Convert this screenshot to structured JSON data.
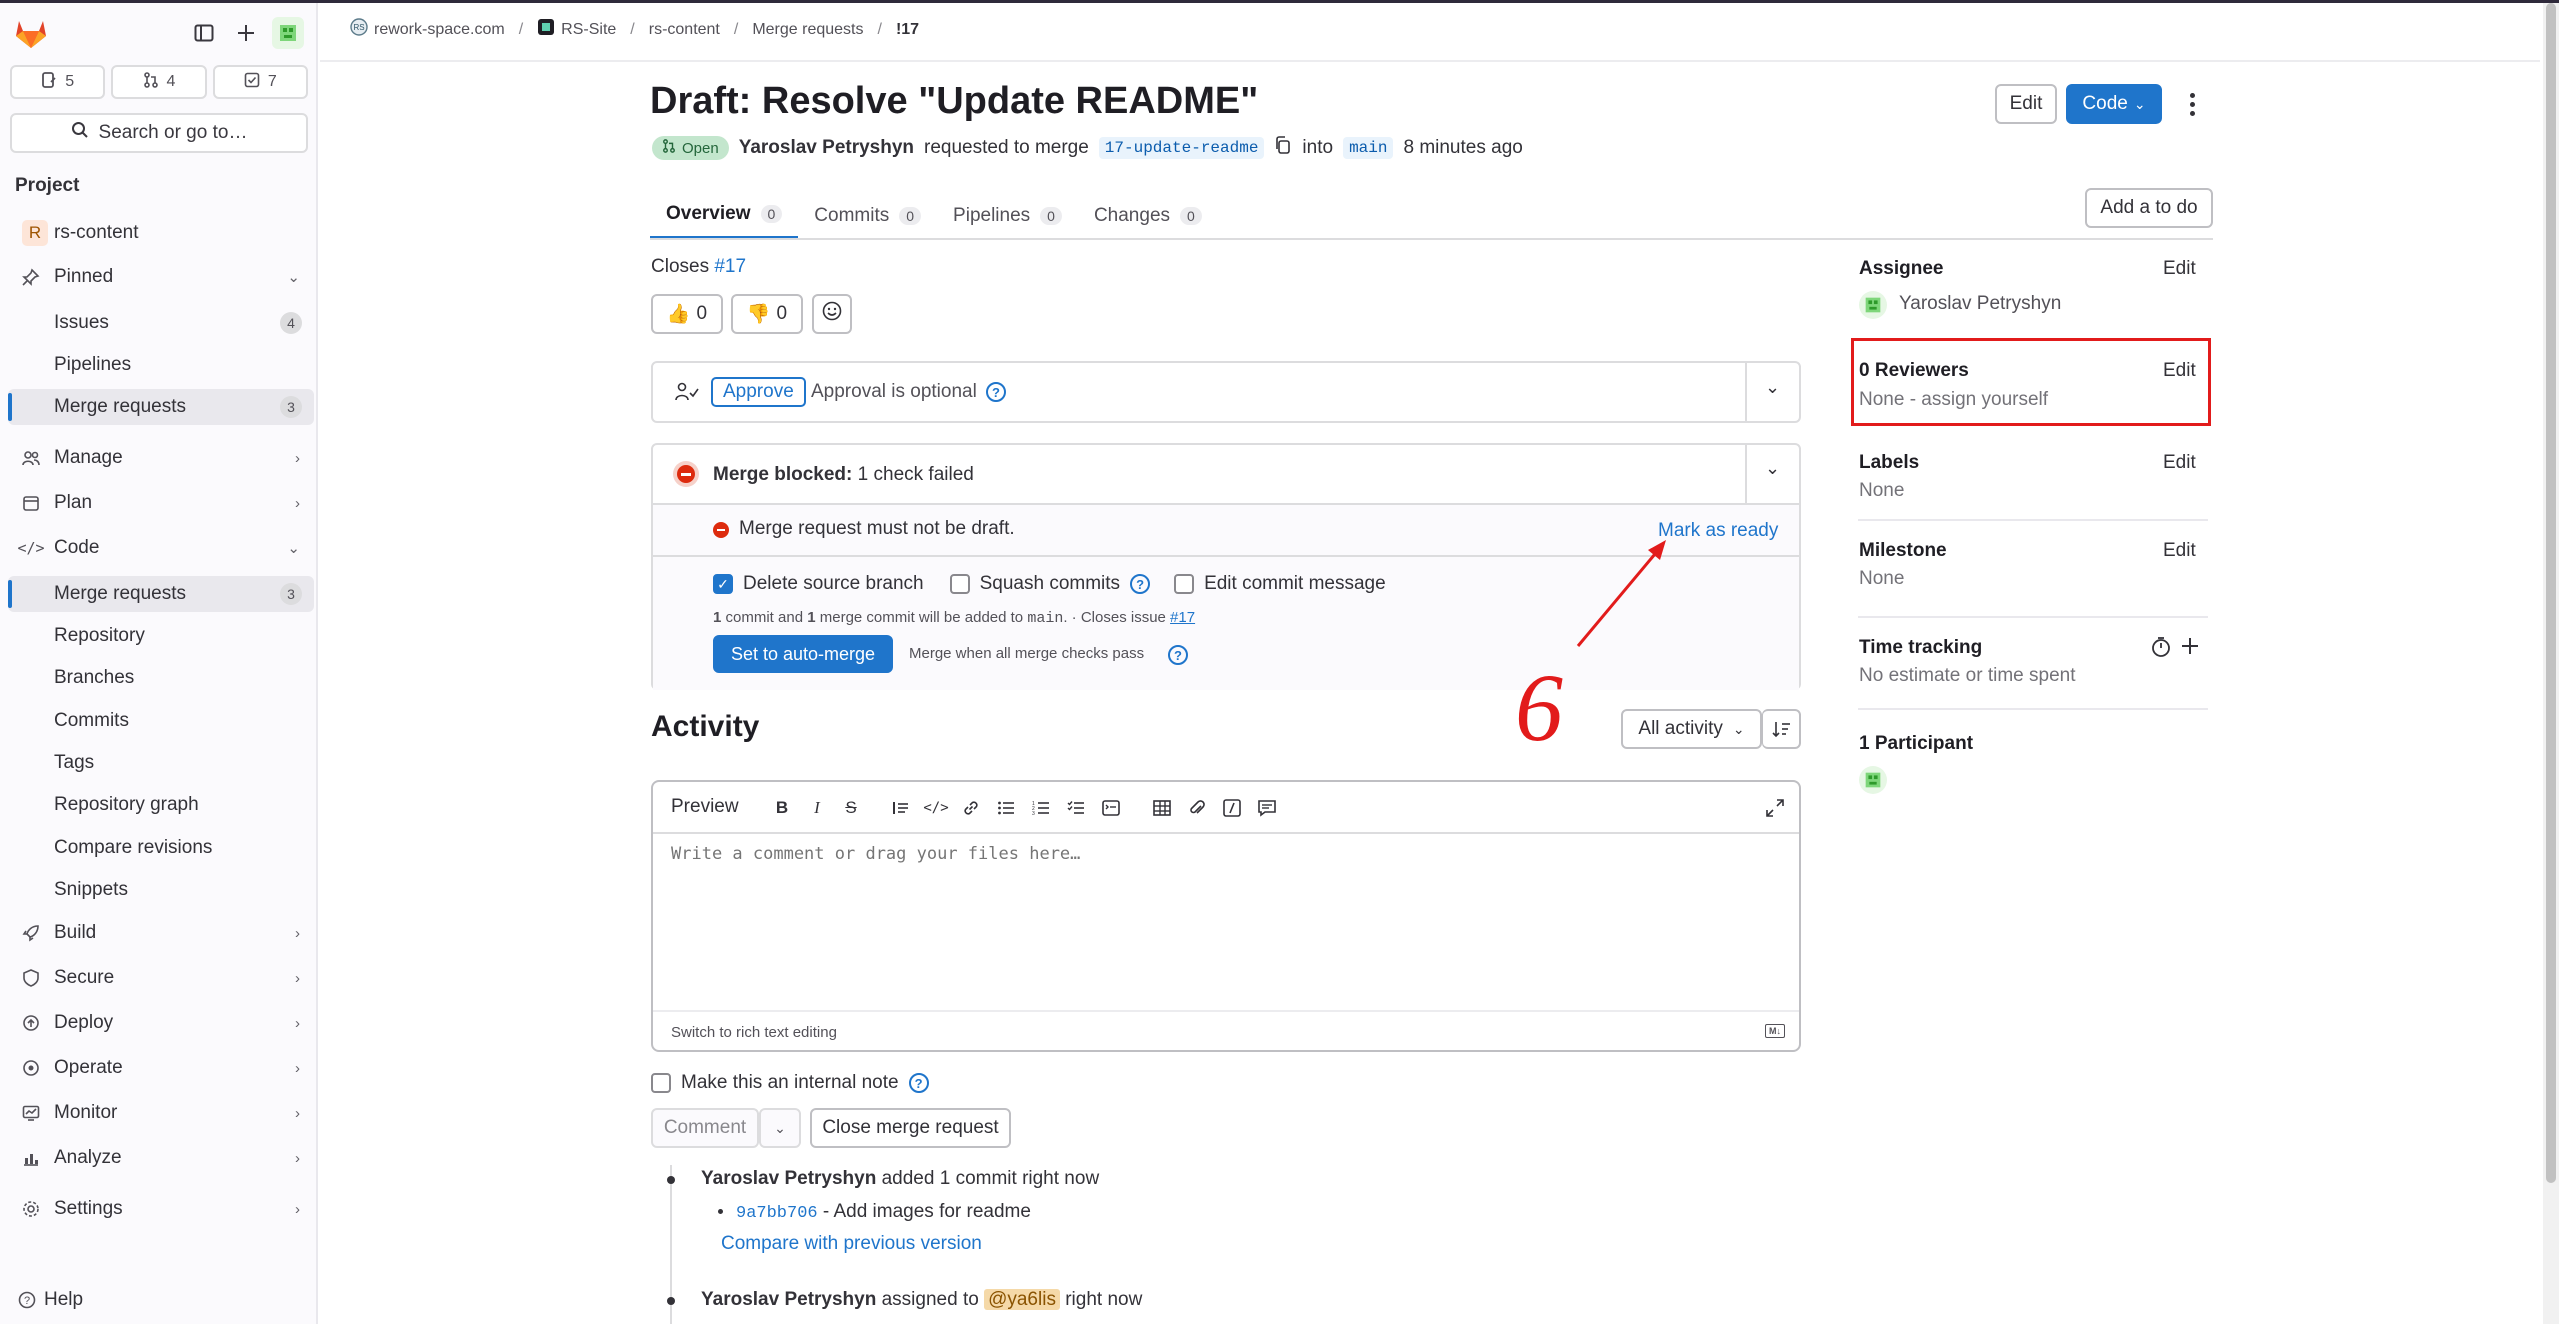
{
  "counts": {
    "issues": "5",
    "mrs": "4",
    "todos": "7"
  },
  "search_label": "Search or go to…",
  "sidebar": {
    "project_heading": "Project",
    "project_name": "rs-content",
    "project_initial": "R",
    "pinned": "Pinned",
    "pinned_items": [
      {
        "label": "Issues",
        "badge": "4"
      },
      {
        "label": "Pipelines",
        "badge": ""
      },
      {
        "label": "Merge requests",
        "badge": "3"
      }
    ],
    "manage": "Manage",
    "plan": "Plan",
    "code": "Code",
    "code_items": [
      {
        "label": "Merge requests",
        "badge": "3"
      },
      {
        "label": "Repository"
      },
      {
        "label": "Branches"
      },
      {
        "label": "Commits"
      },
      {
        "label": "Tags"
      },
      {
        "label": "Repository graph"
      },
      {
        "label": "Compare revisions"
      },
      {
        "label": "Snippets"
      }
    ],
    "build": "Build",
    "secure": "Secure",
    "deploy": "Deploy",
    "operate": "Operate",
    "monitor": "Monitor",
    "analyze": "Analyze",
    "settings": "Settings",
    "help": "Help"
  },
  "breadcrumb": [
    "rework-space.com",
    "RS-Site",
    "rs-content",
    "Merge requests",
    "!17"
  ],
  "mr": {
    "title": "Draft: Resolve \"Update README\"",
    "status": "Open",
    "author": "Yaroslav Petryshyn",
    "requested_text": "requested to merge",
    "source_branch": "17-update-readme",
    "into_text": "into",
    "target_branch": "main",
    "time": "8 minutes ago",
    "edit_label": "Edit",
    "code_label": "Code",
    "todo_label": "Add a to do"
  },
  "tabs": [
    {
      "label": "Overview",
      "count": "0"
    },
    {
      "label": "Commits",
      "count": "0"
    },
    {
      "label": "Pipelines",
      "count": "0"
    },
    {
      "label": "Changes",
      "count": "0"
    }
  ],
  "closes": {
    "prefix": "Closes",
    "issue": "#17"
  },
  "reactions": {
    "thumbs_up": "0",
    "thumbs_down": "0"
  },
  "approval": {
    "button": "Approve",
    "text": "Approval is optional"
  },
  "merge": {
    "blocked_title": "Merge blocked:",
    "blocked_detail": "1 check failed",
    "draft_msg": "Merge request must not be draft.",
    "mark_ready": "Mark as ready",
    "delete_branch": "Delete source branch",
    "squash": "Squash commits",
    "edit_commit": "Edit commit message",
    "summary_a": "1",
    "summary_b": " commit and ",
    "summary_c": "1",
    "summary_d": " merge commit will be added to ",
    "summary_branch": "main",
    "summary_e": ". · Closes issue ",
    "summary_issue": "#17",
    "auto_merge": "Set to auto-merge",
    "auto_merge_hint": "Merge when all merge checks pass"
  },
  "annotation_number": "6",
  "activity": {
    "heading": "Activity",
    "filter": "All activity",
    "preview": "Preview",
    "placeholder": "Write a comment or drag your files here…",
    "rich_text": "Switch to rich text editing",
    "internal_note": "Make this an internal note",
    "comment_btn": "Comment",
    "close_btn": "Close merge request",
    "events": [
      {
        "author": "Yaroslav Petryshyn",
        "action": "added 1 commit right now"
      },
      {
        "author": "Yaroslav Petryshyn",
        "action_a": "assigned to",
        "mention": "@ya6lis",
        "action_b": "right now"
      }
    ],
    "commit_sha": "9a7bb706",
    "commit_msg": "- Add images for readme",
    "compare_link": "Compare with previous version"
  },
  "right": {
    "assignee_title": "Assignee",
    "assignee_name": "Yaroslav Petryshyn",
    "reviewers_title": "0 Reviewers",
    "reviewers_val": "None - assign yourself",
    "labels_title": "Labels",
    "labels_val": "None",
    "milestone_title": "Milestone",
    "milestone_val": "None",
    "time_title": "Time tracking",
    "time_val": "No estimate or time spent",
    "participants_title": "1 Participant",
    "edit": "Edit"
  },
  "colors": {
    "primary": "#1f75cb",
    "annotation_red": "#e21b1b",
    "danger": "#dd2b0e"
  }
}
